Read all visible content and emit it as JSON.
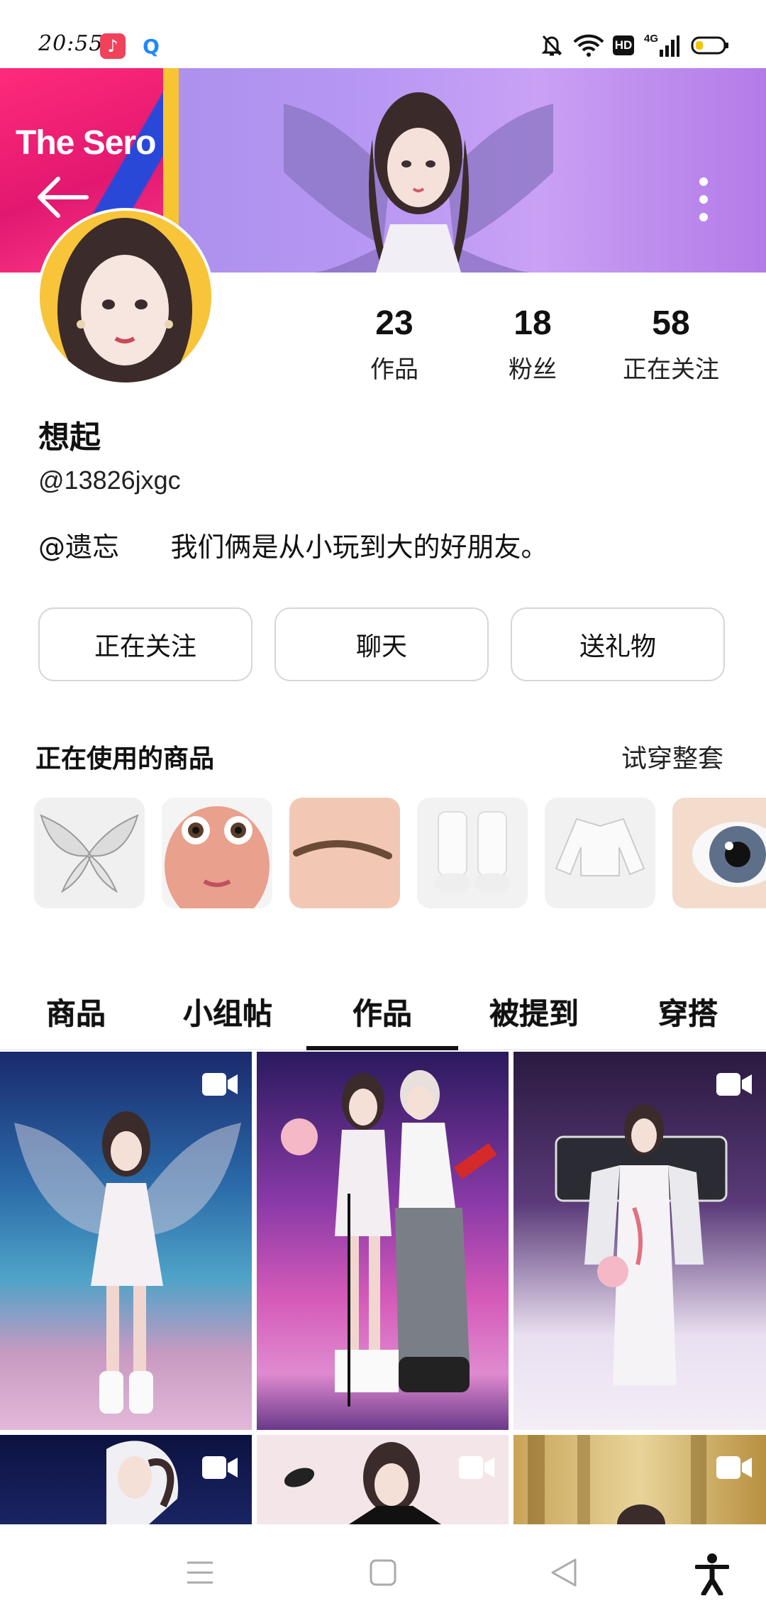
{
  "status_bar": {
    "time": "20:55",
    "icons": [
      "music-app-icon",
      "search-app-icon",
      "mute-icon",
      "wifi-icon",
      "hd-icon",
      "4g-signal-icon",
      "battery-icon"
    ],
    "network": "4G",
    "hd": "HD"
  },
  "banner": {
    "brand_text": "The Sero"
  },
  "profile": {
    "nickname": "想起",
    "user_id": "@13826jxgc",
    "bio": "@遗忘      我们俩是从小玩到大的好朋友。",
    "stats": [
      {
        "value": "23",
        "label": "作品"
      },
      {
        "value": "18",
        "label": "粉丝"
      },
      {
        "value": "58",
        "label": "正在关注"
      }
    ]
  },
  "actions": {
    "follow": "正在关注",
    "chat": "聊天",
    "gift": "送礼物"
  },
  "items_section": {
    "title": "正在使用的商品",
    "try_all": "试穿整套",
    "items": [
      "wings",
      "face",
      "eyebrow",
      "boots",
      "jacket",
      "eye"
    ]
  },
  "tabs": [
    {
      "label": "商品",
      "active": false
    },
    {
      "label": "小组帖",
      "active": false
    },
    {
      "label": "作品",
      "active": true
    },
    {
      "label": "被提到",
      "active": false
    },
    {
      "label": "穿搭",
      "active": false
    }
  ],
  "colors": {
    "avatar_bg": "#f7c43a",
    "banner": "#b596f3",
    "accent_pink": "#e21870"
  },
  "nav": {
    "icons": [
      "menu-icon",
      "home-icon",
      "back-icon",
      "accessibility-icon"
    ]
  }
}
